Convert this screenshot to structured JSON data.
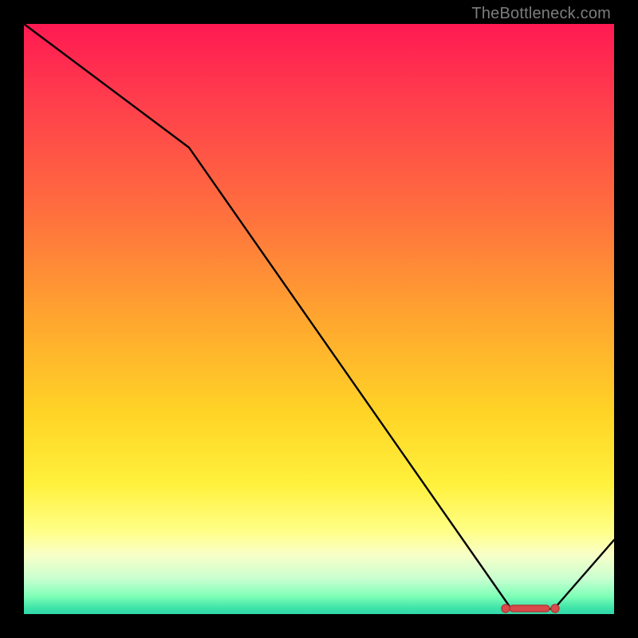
{
  "watermark": "TheBottleneck.com",
  "chart_data": {
    "type": "line",
    "title": "",
    "xlabel": "",
    "ylabel": "",
    "xlim": [
      0,
      100
    ],
    "ylim": [
      0,
      100
    ],
    "grid": false,
    "series": [
      {
        "name": "curve",
        "x": [
          0,
          28,
          82.5,
          90,
          100
        ],
        "values": [
          100,
          79,
          1,
          1,
          12.5
        ]
      }
    ],
    "markers": {
      "name": "highlight-cluster",
      "x": [
        82,
        84,
        86,
        88,
        90
      ],
      "values": [
        1,
        1,
        1,
        1,
        1
      ]
    },
    "background": "red-orange-yellow-green vertical gradient"
  }
}
